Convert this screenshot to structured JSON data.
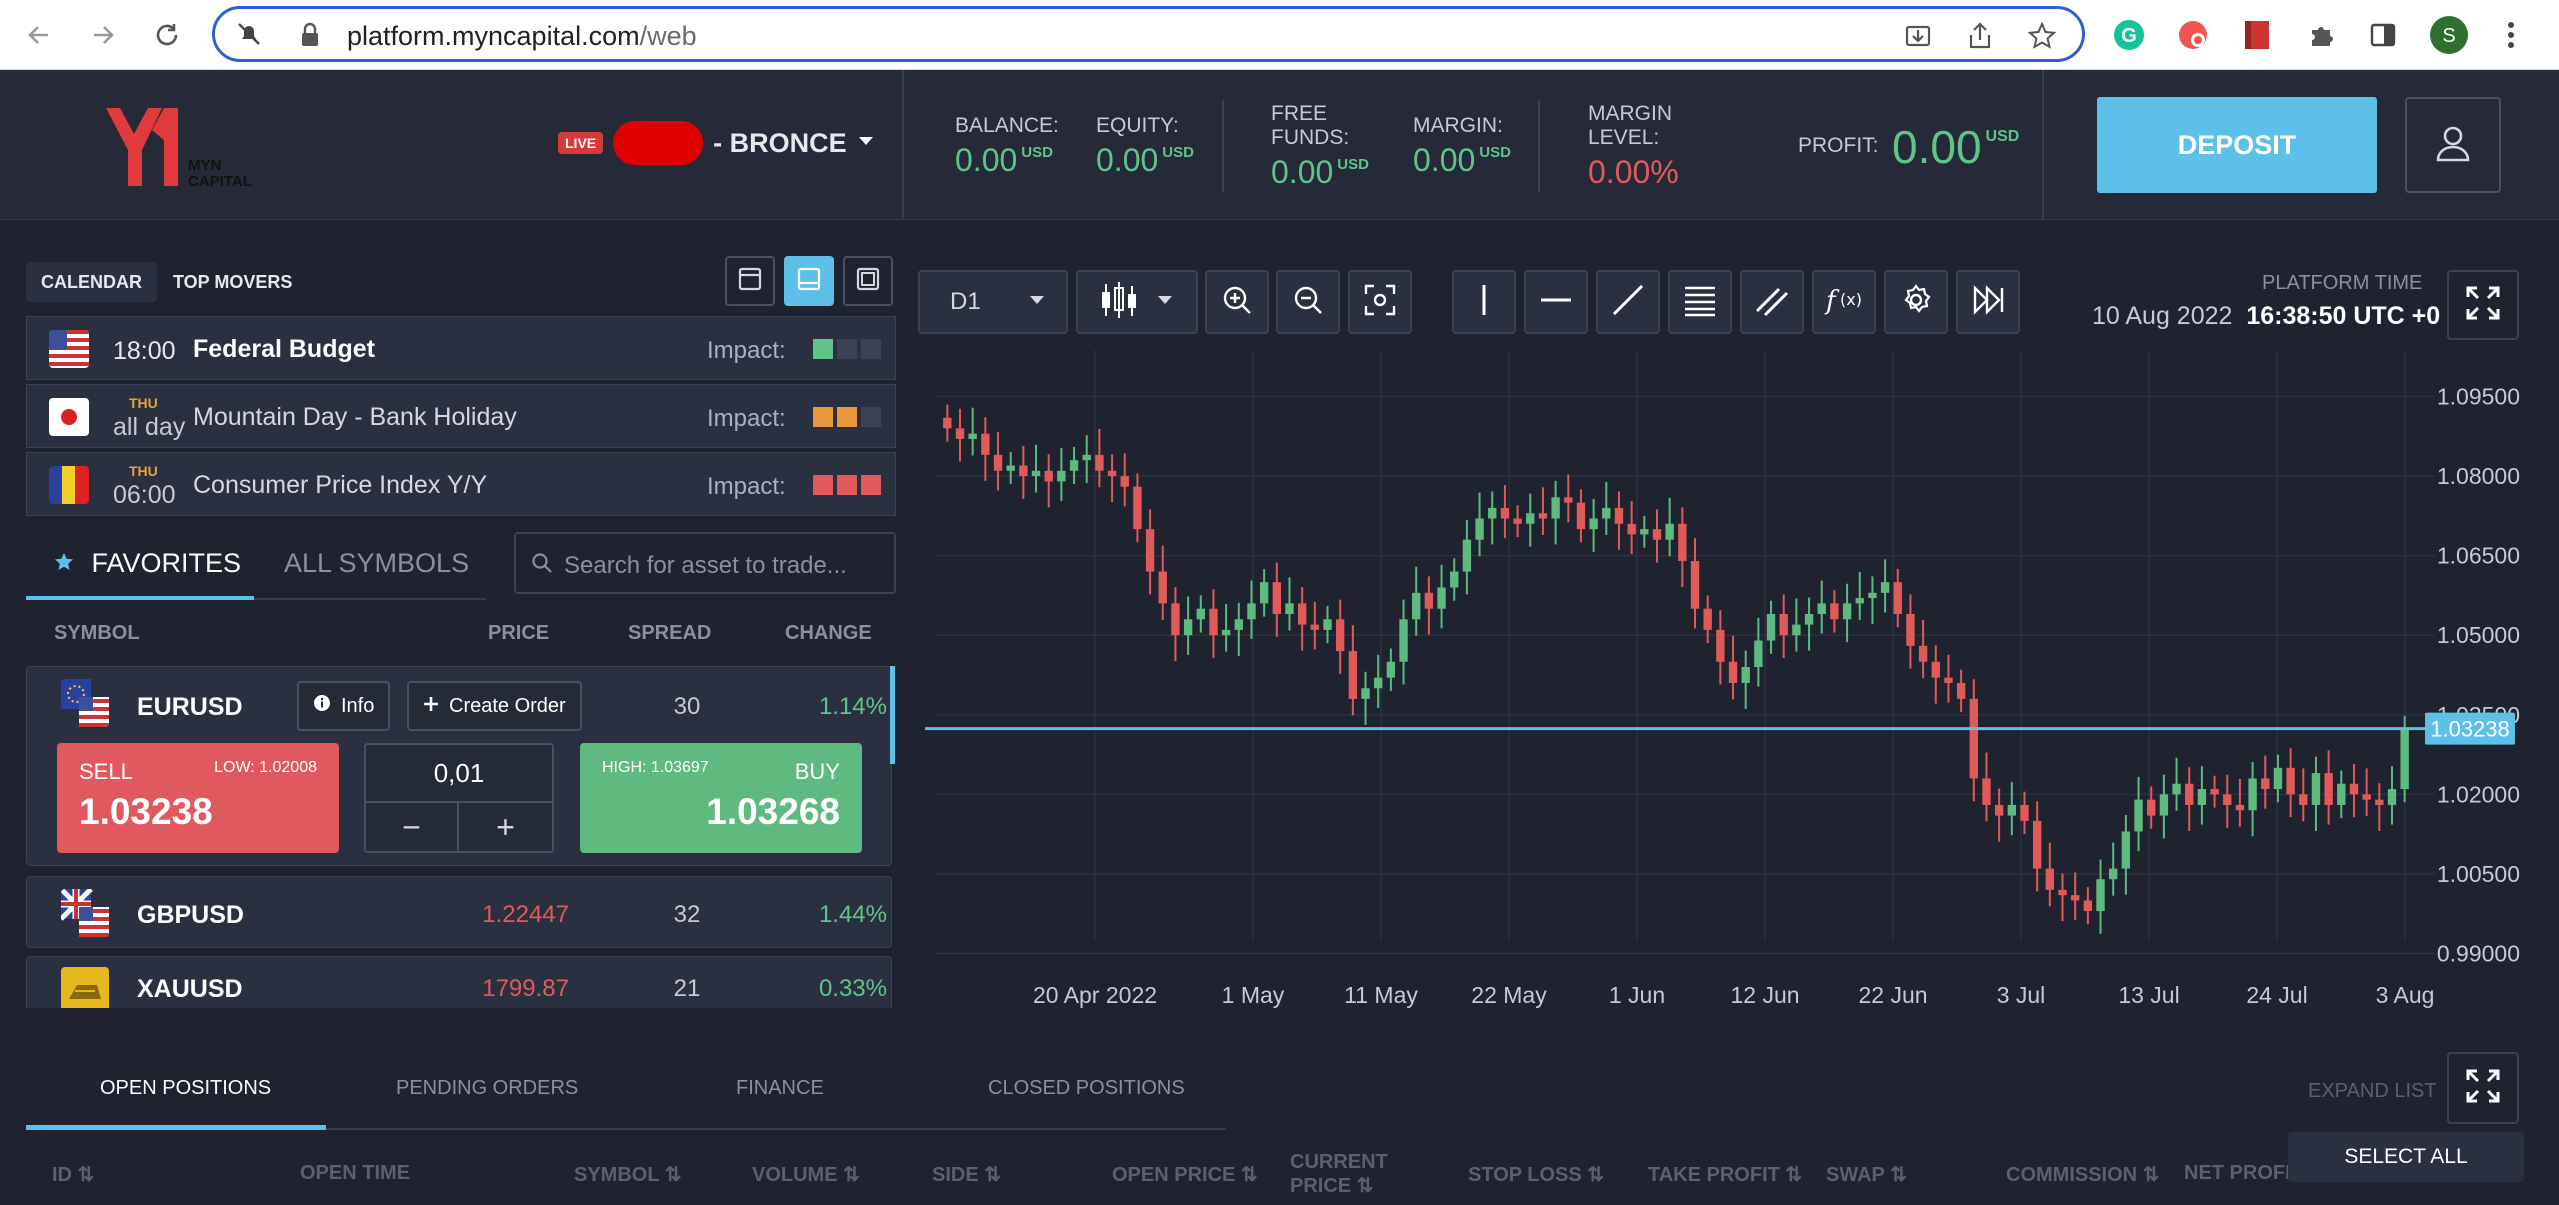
{
  "browser": {
    "url_domain": "platform.myncapital.com",
    "url_path": "/web",
    "profile_initial": "S"
  },
  "header": {
    "logo_text_1": "MYN",
    "logo_text_2": "CAPITAL",
    "live_badge": "LIVE",
    "account_name": "- BRONCE",
    "balance_label": "BALANCE:",
    "balance_value": "0.00",
    "equity_label": "EQUITY:",
    "equity_value": "0.00",
    "free_funds_label_1": "FREE",
    "free_funds_label_2": "FUNDS:",
    "free_funds_value": "0.00",
    "margin_label": "MARGIN:",
    "margin_value": "0.00",
    "margin_level_label_1": "MARGIN",
    "margin_level_label_2": "LEVEL:",
    "margin_level_value": "0.00%",
    "profit_label": "PROFIT:",
    "profit_value": "0.00",
    "currency": "USD",
    "deposit_label": "DEPOSIT"
  },
  "left": {
    "tab_calendar": "CALENDAR",
    "tab_top_movers": "TOP MOVERS",
    "calendar": [
      {
        "time": "18:00",
        "day": "",
        "title": "Federal Budget",
        "impact_label": "Impact:"
      },
      {
        "time": "all day",
        "day": "THU",
        "title": "Mountain Day - Bank Holiday",
        "impact_label": "Impact:"
      },
      {
        "time": "06:00",
        "day": "THU",
        "title": "Consumer Price Index Y/Y",
        "impact_label": "Impact:"
      }
    ],
    "tab_favorites": "FAVORITES",
    "tab_all_symbols": "ALL SYMBOLS",
    "search_placeholder": "Search for asset to trade...",
    "col_symbol": "SYMBOL",
    "col_price": "PRICE",
    "col_spread": "SPREAD",
    "col_change": "CHANGE",
    "eurusd": {
      "symbol": "EURUSD",
      "info_label": "Info",
      "create_order_label": "Create Order",
      "spread": "30",
      "change": "1.14%",
      "sell_label": "SELL",
      "low_label": "LOW: 1.02008",
      "sell_price": "1.03238",
      "quantity": "0,01",
      "minus": "−",
      "plus": "+",
      "high_label": "HIGH: 1.03697",
      "buy_label": "BUY",
      "buy_price": "1.03268"
    },
    "gbpusd": {
      "symbol": "GBPUSD",
      "price": "1.22447",
      "spread": "32",
      "change": "1.44%"
    },
    "xauusd": {
      "symbol": "XAUUSD",
      "price": "1799.87",
      "spread": "21",
      "change": "0.33%"
    }
  },
  "chart": {
    "timeframe": "D1",
    "platform_time_label": "PLATFORM TIME",
    "platform_date": "10 Aug 2022",
    "platform_time": "16:38:50 UTC +0"
  },
  "chart_data": {
    "type": "candlestick",
    "x_tick_labels": [
      "20 Apr 2022",
      "1 May",
      "11 May",
      "22 May",
      "1 Jun",
      "12 Jun",
      "22 Jun",
      "3 Jul",
      "13 Jul",
      "24 Jul",
      "3 Aug"
    ],
    "y_tick_labels": [
      "1.09500",
      "1.08000",
      "1.06500",
      "1.05000",
      "1.03500",
      "1.02000",
      "1.00500",
      "0.99000"
    ],
    "ylim": [
      0.985,
      1.1
    ],
    "current_price": 1.03238,
    "current_price_label": "1.03238",
    "grid": true,
    "closes": [
      1.089,
      1.087,
      1.088,
      1.084,
      1.081,
      1.082,
      1.08,
      1.081,
      1.079,
      1.081,
      1.083,
      1.084,
      1.081,
      1.08,
      1.078,
      1.07,
      1.062,
      1.056,
      1.05,
      1.053,
      1.055,
      1.05,
      1.051,
      1.053,
      1.056,
      1.06,
      1.054,
      1.056,
      1.052,
      1.051,
      1.053,
      1.047,
      1.038,
      1.04,
      1.042,
      1.045,
      1.053,
      1.058,
      1.055,
      1.059,
      1.062,
      1.068,
      1.072,
      1.074,
      1.072,
      1.071,
      1.073,
      1.072,
      1.076,
      1.075,
      1.07,
      1.072,
      1.074,
      1.071,
      1.069,
      1.07,
      1.068,
      1.071,
      1.064,
      1.055,
      1.051,
      1.045,
      1.041,
      1.044,
      1.049,
      1.054,
      1.05,
      1.052,
      1.054,
      1.056,
      1.053,
      1.056,
      1.057,
      1.058,
      1.06,
      1.054,
      1.048,
      1.045,
      1.042,
      1.041,
      1.038,
      1.023,
      1.018,
      1.016,
      1.018,
      1.015,
      1.006,
      1.002,
      1.001,
      1.0,
      0.998,
      1.004,
      1.006,
      1.013,
      1.019,
      1.016,
      1.02,
      1.022,
      1.018,
      1.021,
      1.02,
      1.018,
      1.017,
      1.023,
      1.021,
      1.025,
      1.02,
      1.018,
      1.024,
      1.018,
      1.022,
      1.02,
      1.019,
      1.018,
      1.021,
      1.0323
    ]
  },
  "bottom": {
    "tab_open_positions": "OPEN POSITIONS",
    "tab_pending_orders": "PENDING ORDERS",
    "tab_finance": "FINANCE",
    "tab_closed_positions": "CLOSED POSITIONS",
    "expand_list": "EXPAND LIST",
    "select_all": "SELECT ALL",
    "columns": [
      "ID",
      "OPEN TIME",
      "SYMBOL",
      "VOLUME",
      "SIDE",
      "OPEN PRICE",
      "CURRENT PRICE",
      "STOP LOSS",
      "TAKE PROFIT",
      "SWAP",
      "COMMISSION",
      "NET PROFIT"
    ]
  },
  "colors": {
    "accent": "#5cc0e8",
    "green": "#5fc48a",
    "red": "#e05a5a",
    "bg": "#1f2330"
  }
}
